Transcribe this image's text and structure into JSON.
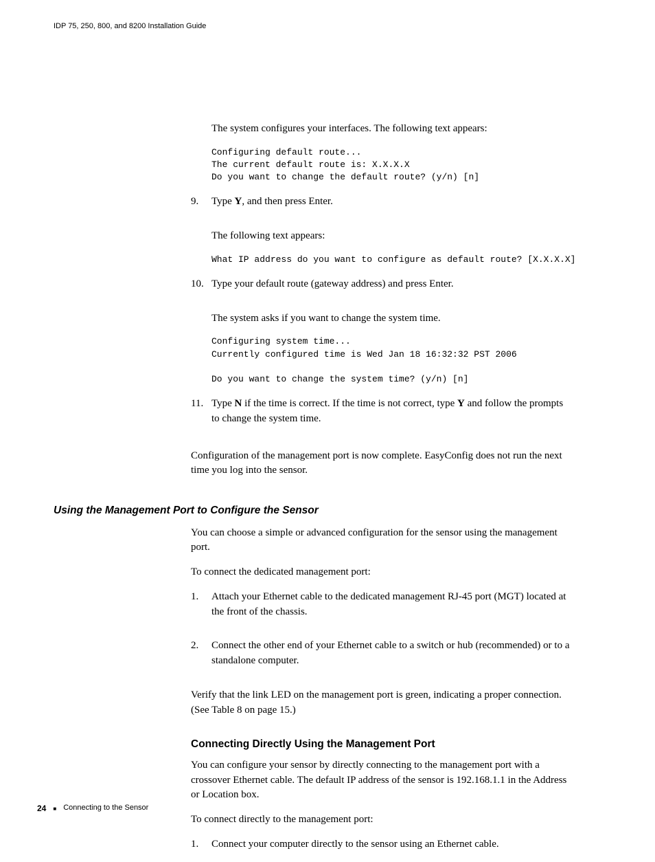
{
  "header": {
    "title": "IDP 75, 250, 800, and 8200 Installation Guide"
  },
  "body": {
    "p1": "The system configures your interfaces. The following text appears:",
    "code1": "Configuring default route...\nThe current default route is: X.X.X.X\nDo you want to change the default route? (y/n) [n]",
    "step9": {
      "num": "9.",
      "prefix": "Type ",
      "bold": "Y",
      "suffix": ", and then press Enter."
    },
    "p2": "The following text appears:",
    "code2": "What IP address do you want to configure as default route? [X.X.X.X]",
    "step10": {
      "num": "10.",
      "text": "Type your default route (gateway address) and press Enter."
    },
    "p3": "The system asks if you want to change the system time.",
    "code3": "Configuring system time...\nCurrently configured time is Wed Jan 18 16:32:32 PST 2006\n\nDo you want to change the system time? (y/n) [n]",
    "step11": {
      "num": "11.",
      "t1": "Type ",
      "b1": "N",
      "t2": " if the time is correct. If the time is not correct, type ",
      "b2": "Y",
      "t3": " and follow the prompts to change the system time."
    },
    "p4": "Configuration of the management port is now complete. EasyConfig does not run the next time you log into the sensor."
  },
  "sectionA": {
    "title": "Using the Management Port to Configure the Sensor",
    "p1": "You can choose a simple or advanced configuration for the sensor using the management port.",
    "p2": "To connect the dedicated management port:",
    "step1": {
      "num": "1.",
      "text": "Attach your Ethernet cable to the dedicated management RJ-45 port (MGT) located at the front of the chassis."
    },
    "step2": {
      "num": "2.",
      "text": "Connect the other end of your Ethernet cable to a switch or hub (recommended) or to a standalone computer."
    },
    "p3": "Verify that the link LED on the management port is green, indicating a proper connection. (See Table 8 on page 15.)"
  },
  "sectionB": {
    "title": "Connecting Directly Using the Management Port",
    "p1": "You can configure your sensor by directly connecting to the management port with a crossover Ethernet cable. The default IP address of the sensor is 192.168.1.1 in the Address or Location box.",
    "p2": "To connect directly to the management port:",
    "step1": {
      "num": "1.",
      "text": "Connect your computer directly to the sensor using an Ethernet cable."
    }
  },
  "footer": {
    "page": "24",
    "bullet": "■",
    "section": "Connecting to the Sensor"
  }
}
